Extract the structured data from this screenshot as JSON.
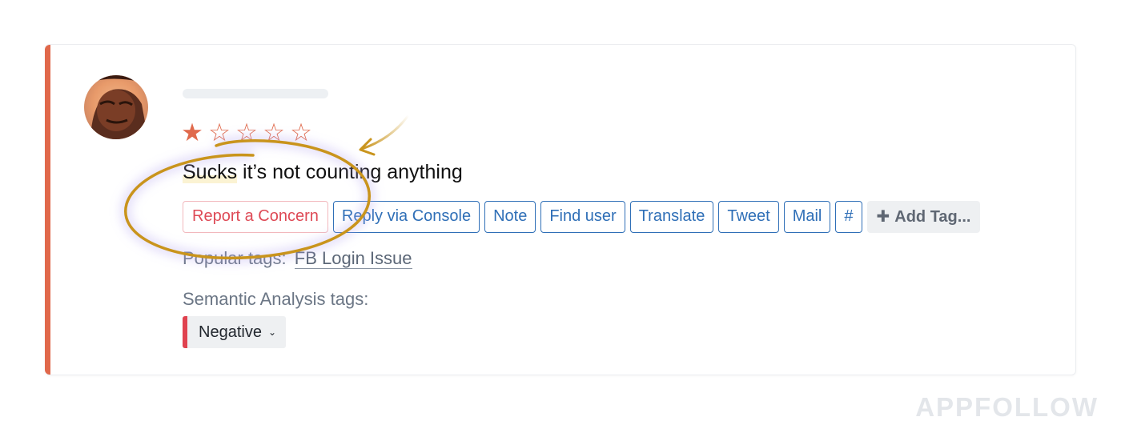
{
  "review": {
    "rating": 1,
    "max_rating": 5,
    "text_highlight": "Sucks",
    "text_rest": " it’s not counting anything"
  },
  "actions": [
    {
      "label": "Report a Concern",
      "name": "report-concern-button",
      "variant": "danger"
    },
    {
      "label": "Reply via Console",
      "name": "reply-via-console-button",
      "variant": "primary"
    },
    {
      "label": "Note",
      "name": "note-button",
      "variant": "primary"
    },
    {
      "label": "Find user",
      "name": "find-user-button",
      "variant": "primary"
    },
    {
      "label": "Translate",
      "name": "translate-button",
      "variant": "primary"
    },
    {
      "label": "Tweet",
      "name": "tweet-button",
      "variant": "primary"
    },
    {
      "label": "Mail",
      "name": "mail-button",
      "variant": "primary"
    },
    {
      "label": "#",
      "name": "hashtag-button",
      "variant": "primary"
    }
  ],
  "add_tag_label": "Add Tag...",
  "popular_tags": {
    "label": "Popular tags:",
    "tags": [
      "FB Login Issue"
    ]
  },
  "semantic": {
    "label": "Semantic Analysis tags:",
    "value": "Negative"
  },
  "watermark": "APPFOLLOW",
  "colors": {
    "accent_bar": "#e0684b",
    "star_filled": "#e06a4c",
    "star_empty": "#e06a4c",
    "primary": "#2f6fb7",
    "danger": "#de4a56",
    "negative_marker": "#e0424f",
    "annotation_stroke": "#c9941c"
  },
  "icons": {
    "star_filled": "★",
    "star_empty": "☆",
    "plus": "✚",
    "chevron": "⌄"
  }
}
